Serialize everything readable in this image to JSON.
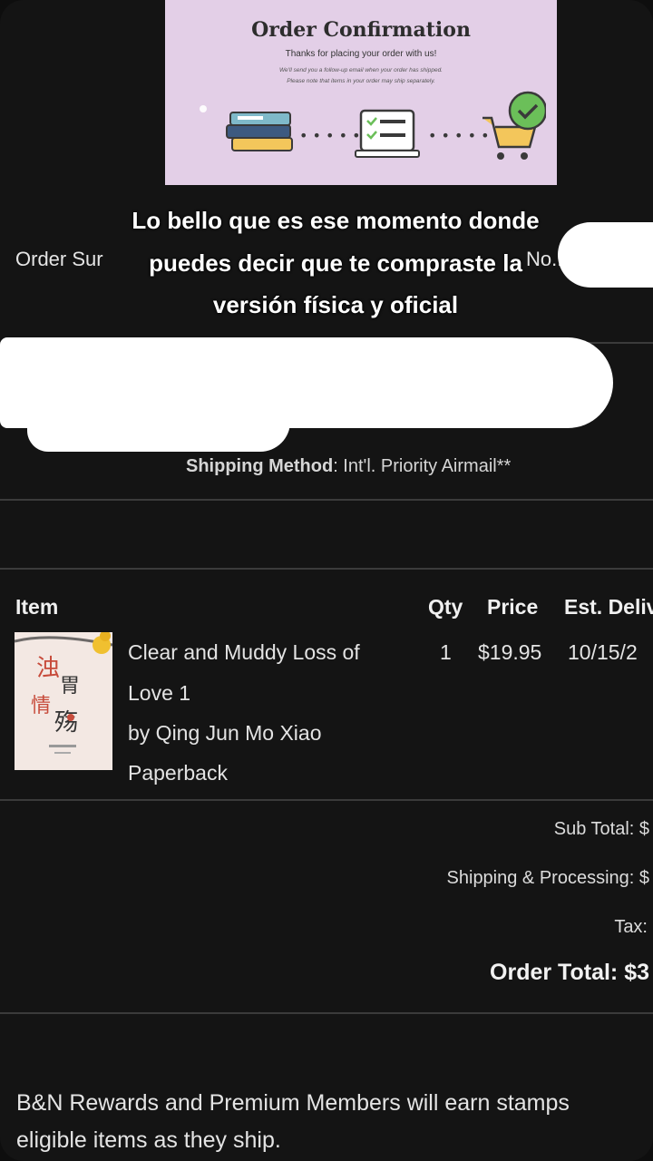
{
  "banner": {
    "title": "Order Confirmation",
    "subtitle": "Thanks for placing your order with us!",
    "small_line_1": "We'll send you a follow-up email when your order has shipped.",
    "small_line_2": "Please note that items in your order may ship separately."
  },
  "caption": {
    "line_1": "Lo bello que es ese momento donde",
    "line_2": "puedes decir que te compraste la",
    "line_3": "versión física y oficial"
  },
  "summary": {
    "left_label": "Order Sur",
    "right_label": "No.:"
  },
  "shipping": {
    "label": "Shipping Method",
    "value": ": Int'l. Priority Airmail**"
  },
  "items_table": {
    "headers": {
      "item": "Item",
      "qty": "Qty",
      "price": "Price",
      "delivery": "Est. Deliv"
    },
    "rows": [
      {
        "title_line_1": "Clear and Muddy Loss of",
        "title_line_2": "Love 1",
        "author": "by Qing Jun Mo Xiao",
        "format": "Paperback",
        "qty": "1",
        "price": "$19.95",
        "delivery": "10/15/2"
      }
    ]
  },
  "totals": {
    "sub_total": "Sub Total: $",
    "shipping": "Shipping & Processing: $",
    "tax": "Tax:",
    "order_total": "Order Total: $3"
  },
  "rewards": {
    "line_1": "B&N Rewards and Premium Members will earn stamps",
    "line_2": "eligible items as they ship."
  },
  "colors": {
    "background": "#141414",
    "banner": "#e3cfe7",
    "text": "#e6e6e6",
    "divider": "#3b3b3b"
  }
}
